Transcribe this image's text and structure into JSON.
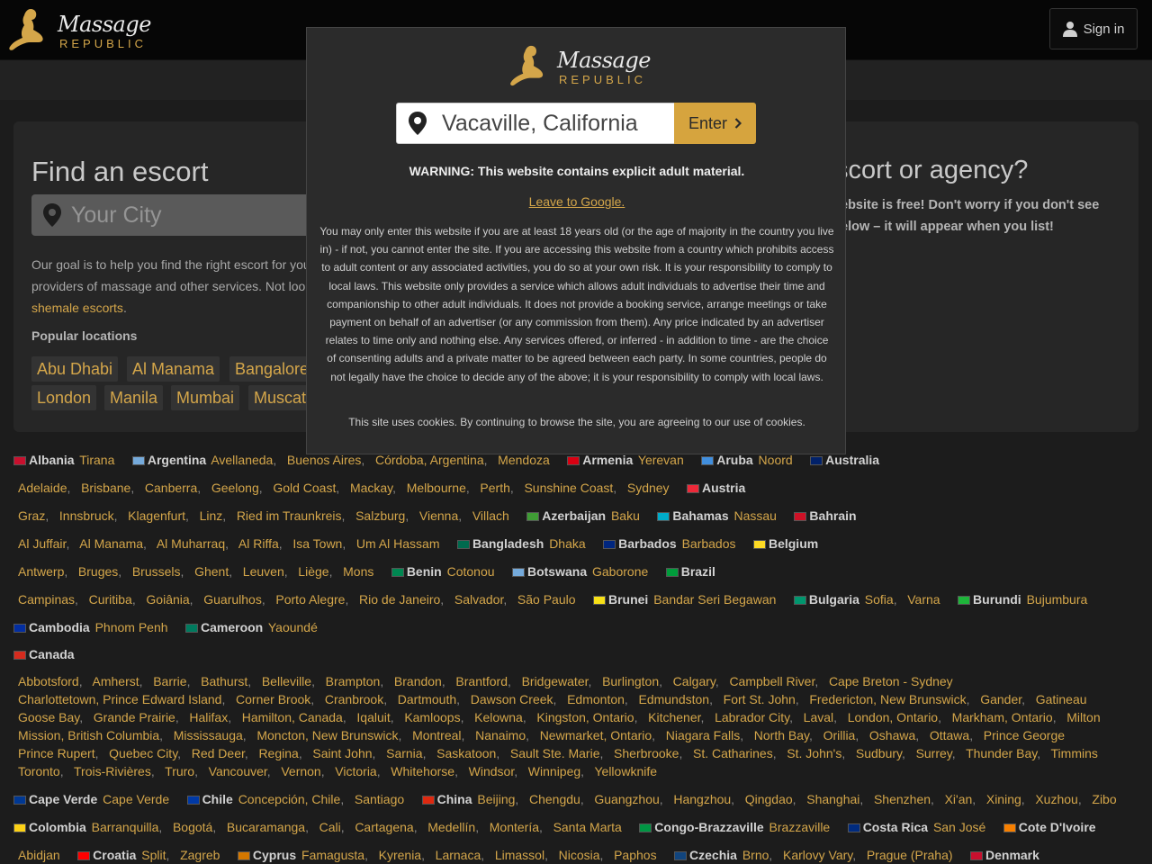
{
  "brand": {
    "word1": "Massage",
    "word2": "REPUBLIC"
  },
  "header": {
    "sign_in": "Sign in"
  },
  "find": {
    "title": "Find an escort",
    "placeholder": "Your City",
    "goal_lines": [
      "Our goal is to help you find the right escort for you",
      "providers of massage and other services. Not loo",
      "shemale escorts"
    ],
    "goal_tail": ".",
    "popular_heading": "Popular locations",
    "popular": [
      "Abu Dhabi",
      "Al Manama",
      "Bangalore",
      "London",
      "Manila",
      "Mumbai",
      "Muscat"
    ]
  },
  "list": {
    "title": "scort or agency?",
    "text_lines": [
      "ebsite is free! Don't worry if you don't see",
      "elow – it will appear when you list!"
    ]
  },
  "modal": {
    "city_value": "Vacaville, California",
    "enter_label": "Enter",
    "warning": "WARNING: This website contains explicit adult material.",
    "leave_link": "Leave to Google.",
    "disclaimer": "You may only enter this website if you are at least 18 years old (or the age of majority in the country you live in) - if not, you cannot enter the site. If you are accessing this website from a country which prohibits access to adult content or any associated activities, you do so at your own risk. It is your responsibility to comply to local laws. This website only provides a service which allows adult individuals to advertise their time and companionship to other adult individuals. It does not provide a booking service, arrange meetings or take payment on behalf of an advertiser (or any commission from them). Any price indicated by an advertiser relates to time only and nothing else. Any services offered, or inferred - in addition to time - are the choice of consenting adults and a private matter to be agreed between each party. In some countries, people do not legally have the choice to decide any of the above; it is your responsibility to comply with local laws.",
    "cookies": "This site uses cookies. By continuing to browse the site, you are agreeing to our use of cookies."
  },
  "country_rows": [
    [
      {
        "t": "c",
        "v": "Albania",
        "f": "#c8102e"
      },
      {
        "t": "city",
        "v": "Tirana"
      },
      {
        "t": "c",
        "v": "Argentina",
        "f": "#75aadb"
      },
      {
        "t": "city",
        "v": "Avellaneda"
      },
      {
        "t": "city",
        "v": "Buenos Aires"
      },
      {
        "t": "city",
        "v": "Córdoba, Argentina"
      },
      {
        "t": "city",
        "v": "Mendoza"
      },
      {
        "t": "c",
        "v": "Armenia",
        "f": "#d90012"
      },
      {
        "t": "city",
        "v": "Yerevan"
      },
      {
        "t": "c",
        "v": "Aruba",
        "f": "#418fde"
      },
      {
        "t": "city",
        "v": "Noord"
      },
      {
        "t": "c",
        "v": "Australia",
        "f": "#012169"
      }
    ],
    [
      {
        "t": "city",
        "v": "Adelaide"
      },
      {
        "t": "city",
        "v": "Brisbane"
      },
      {
        "t": "city",
        "v": "Canberra"
      },
      {
        "t": "city",
        "v": "Geelong"
      },
      {
        "t": "city",
        "v": "Gold Coast"
      },
      {
        "t": "city",
        "v": "Mackay"
      },
      {
        "t": "city",
        "v": "Melbourne"
      },
      {
        "t": "city",
        "v": "Perth"
      },
      {
        "t": "city",
        "v": "Sunshine Coast"
      },
      {
        "t": "city",
        "v": "Sydney"
      },
      {
        "t": "c",
        "v": "Austria",
        "f": "#ed2939"
      }
    ],
    [
      {
        "t": "city",
        "v": "Graz"
      },
      {
        "t": "city",
        "v": "Innsbruck"
      },
      {
        "t": "city",
        "v": "Klagenfurt"
      },
      {
        "t": "city",
        "v": "Linz"
      },
      {
        "t": "city",
        "v": "Ried im Traunkreis"
      },
      {
        "t": "city",
        "v": "Salzburg"
      },
      {
        "t": "city",
        "v": "Vienna"
      },
      {
        "t": "city",
        "v": "Villach"
      },
      {
        "t": "c",
        "v": "Azerbaijan",
        "f": "#3f9c35"
      },
      {
        "t": "city",
        "v": "Baku"
      },
      {
        "t": "c",
        "v": "Bahamas",
        "f": "#00abc9"
      },
      {
        "t": "city",
        "v": "Nassau"
      },
      {
        "t": "c",
        "v": "Bahrain",
        "f": "#ce1126"
      }
    ],
    [
      {
        "t": "city",
        "v": "Al Juffair"
      },
      {
        "t": "city",
        "v": "Al Manama"
      },
      {
        "t": "city",
        "v": "Al Muharraq"
      },
      {
        "t": "city",
        "v": "Al Riffa"
      },
      {
        "t": "city",
        "v": "Isa Town"
      },
      {
        "t": "city",
        "v": "Um Al Hassam"
      },
      {
        "t": "c",
        "v": "Bangladesh",
        "f": "#006a4e"
      },
      {
        "t": "city",
        "v": "Dhaka"
      },
      {
        "t": "c",
        "v": "Barbados",
        "f": "#00267f"
      },
      {
        "t": "city",
        "v": "Barbados"
      },
      {
        "t": "c",
        "v": "Belgium",
        "f": "#fdda24"
      }
    ],
    [
      {
        "t": "city",
        "v": "Antwerp"
      },
      {
        "t": "city",
        "v": "Bruges"
      },
      {
        "t": "city",
        "v": "Brussels"
      },
      {
        "t": "city",
        "v": "Ghent"
      },
      {
        "t": "city",
        "v": "Leuven"
      },
      {
        "t": "city",
        "v": "Liège"
      },
      {
        "t": "city",
        "v": "Mons"
      },
      {
        "t": "c",
        "v": "Benin",
        "f": "#008751"
      },
      {
        "t": "city",
        "v": "Cotonou"
      },
      {
        "t": "c",
        "v": "Botswana",
        "f": "#75aadb"
      },
      {
        "t": "city",
        "v": "Gaborone"
      },
      {
        "t": "c",
        "v": "Brazil",
        "f": "#009c3b"
      }
    ],
    [
      {
        "t": "city",
        "v": "Campinas"
      },
      {
        "t": "city",
        "v": "Curitiba"
      },
      {
        "t": "city",
        "v": "Goiânia"
      },
      {
        "t": "city",
        "v": "Guarulhos"
      },
      {
        "t": "city",
        "v": "Porto Alegre"
      },
      {
        "t": "city",
        "v": "Rio de Janeiro"
      },
      {
        "t": "city",
        "v": "Salvador"
      },
      {
        "t": "city",
        "v": "São Paulo"
      },
      {
        "t": "c",
        "v": "Brunei",
        "f": "#f7e017"
      },
      {
        "t": "city",
        "v": "Bandar Seri Begawan"
      },
      {
        "t": "c",
        "v": "Bulgaria",
        "f": "#00966e"
      },
      {
        "t": "city",
        "v": "Sofia"
      },
      {
        "t": "city",
        "v": "Varna"
      },
      {
        "t": "c",
        "v": "Burundi",
        "f": "#1eb53a"
      },
      {
        "t": "city",
        "v": "Bujumbura"
      }
    ],
    [
      {
        "t": "c",
        "v": "Cambodia",
        "f": "#032ea1"
      },
      {
        "t": "city",
        "v": "Phnom Penh"
      },
      {
        "t": "c",
        "v": "Cameroon",
        "f": "#007a5e"
      },
      {
        "t": "city",
        "v": "Yaoundé"
      }
    ],
    [
      {
        "t": "c",
        "v": "Canada",
        "f": "#d52b1e"
      }
    ],
    [
      {
        "t": "city",
        "v": "Abbotsford"
      },
      {
        "t": "city",
        "v": "Amherst"
      },
      {
        "t": "city",
        "v": "Barrie"
      },
      {
        "t": "city",
        "v": "Bathurst"
      },
      {
        "t": "city",
        "v": "Belleville"
      },
      {
        "t": "city",
        "v": "Brampton"
      },
      {
        "t": "city",
        "v": "Brandon"
      },
      {
        "t": "city",
        "v": "Brantford"
      },
      {
        "t": "city",
        "v": "Bridgewater"
      },
      {
        "t": "city",
        "v": "Burlington"
      },
      {
        "t": "city",
        "v": "Calgary"
      },
      {
        "t": "city",
        "v": "Campbell River"
      },
      {
        "t": "city",
        "v": "Cape Breton - Sydney"
      }
    ],
    [
      {
        "t": "city",
        "v": "Charlottetown, Prince Edward Island"
      },
      {
        "t": "city",
        "v": "Corner Brook"
      },
      {
        "t": "city",
        "v": "Cranbrook"
      },
      {
        "t": "city",
        "v": "Dartmouth"
      },
      {
        "t": "city",
        "v": "Dawson Creek"
      },
      {
        "t": "city",
        "v": "Edmonton"
      },
      {
        "t": "city",
        "v": "Edmundston"
      },
      {
        "t": "city",
        "v": "Fort St. John"
      },
      {
        "t": "city",
        "v": "Fredericton, New Brunswick"
      },
      {
        "t": "city",
        "v": "Gander"
      },
      {
        "t": "city",
        "v": "Gatineau"
      }
    ],
    [
      {
        "t": "city",
        "v": "Goose Bay"
      },
      {
        "t": "city",
        "v": "Grande Prairie"
      },
      {
        "t": "city",
        "v": "Halifax"
      },
      {
        "t": "city",
        "v": "Hamilton, Canada"
      },
      {
        "t": "city",
        "v": "Iqaluit"
      },
      {
        "t": "city",
        "v": "Kamloops"
      },
      {
        "t": "city",
        "v": "Kelowna"
      },
      {
        "t": "city",
        "v": "Kingston, Ontario"
      },
      {
        "t": "city",
        "v": "Kitchener"
      },
      {
        "t": "city",
        "v": "Labrador City"
      },
      {
        "t": "city",
        "v": "Laval"
      },
      {
        "t": "city",
        "v": "London, Ontario"
      },
      {
        "t": "city",
        "v": "Markham, Ontario"
      },
      {
        "t": "city",
        "v": "Milton"
      }
    ],
    [
      {
        "t": "city",
        "v": "Mission, British Columbia"
      },
      {
        "t": "city",
        "v": "Mississauga"
      },
      {
        "t": "city",
        "v": "Moncton, New Brunswick"
      },
      {
        "t": "city",
        "v": "Montreal"
      },
      {
        "t": "city",
        "v": "Nanaimo"
      },
      {
        "t": "city",
        "v": "Newmarket, Ontario"
      },
      {
        "t": "city",
        "v": "Niagara Falls"
      },
      {
        "t": "city",
        "v": "North Bay"
      },
      {
        "t": "city",
        "v": "Orillia"
      },
      {
        "t": "city",
        "v": "Oshawa"
      },
      {
        "t": "city",
        "v": "Ottawa"
      },
      {
        "t": "city",
        "v": "Prince George"
      }
    ],
    [
      {
        "t": "city",
        "v": "Prince Rupert"
      },
      {
        "t": "city",
        "v": "Quebec City"
      },
      {
        "t": "city",
        "v": "Red Deer"
      },
      {
        "t": "city",
        "v": "Regina"
      },
      {
        "t": "city",
        "v": "Saint John"
      },
      {
        "t": "city",
        "v": "Sarnia"
      },
      {
        "t": "city",
        "v": "Saskatoon"
      },
      {
        "t": "city",
        "v": "Sault Ste. Marie"
      },
      {
        "t": "city",
        "v": "Sherbrooke"
      },
      {
        "t": "city",
        "v": "St. Catharines"
      },
      {
        "t": "city",
        "v": "St. John's"
      },
      {
        "t": "city",
        "v": "Sudbury"
      },
      {
        "t": "city",
        "v": "Surrey"
      },
      {
        "t": "city",
        "v": "Thunder Bay"
      },
      {
        "t": "city",
        "v": "Timmins"
      }
    ],
    [
      {
        "t": "city",
        "v": "Toronto"
      },
      {
        "t": "city",
        "v": "Trois-Rivières"
      },
      {
        "t": "city",
        "v": "Truro"
      },
      {
        "t": "city",
        "v": "Vancouver"
      },
      {
        "t": "city",
        "v": "Vernon"
      },
      {
        "t": "city",
        "v": "Victoria"
      },
      {
        "t": "city",
        "v": "Whitehorse"
      },
      {
        "t": "city",
        "v": "Windsor"
      },
      {
        "t": "city",
        "v": "Winnipeg"
      },
      {
        "t": "city",
        "v": "Yellowknife"
      }
    ],
    [
      {
        "t": "c",
        "v": "Cape Verde",
        "f": "#003893"
      },
      {
        "t": "city",
        "v": "Cape Verde"
      },
      {
        "t": "c",
        "v": "Chile",
        "f": "#0039a6"
      },
      {
        "t": "city",
        "v": "Concepción, Chile"
      },
      {
        "t": "city",
        "v": "Santiago"
      },
      {
        "t": "c",
        "v": "China",
        "f": "#de2910"
      },
      {
        "t": "city",
        "v": "Beijing"
      },
      {
        "t": "city",
        "v": "Chengdu"
      },
      {
        "t": "city",
        "v": "Guangzhou"
      },
      {
        "t": "city",
        "v": "Hangzhou"
      },
      {
        "t": "city",
        "v": "Qingdao"
      },
      {
        "t": "city",
        "v": "Shanghai"
      },
      {
        "t": "city",
        "v": "Shenzhen"
      },
      {
        "t": "city",
        "v": "Xi'an"
      },
      {
        "t": "city",
        "v": "Xining"
      },
      {
        "t": "city",
        "v": "Xuzhou"
      },
      {
        "t": "city",
        "v": "Zibo"
      }
    ],
    [
      {
        "t": "c",
        "v": "Colombia",
        "f": "#fcd116"
      },
      {
        "t": "city",
        "v": "Barranquilla"
      },
      {
        "t": "city",
        "v": "Bogotá"
      },
      {
        "t": "city",
        "v": "Bucaramanga"
      },
      {
        "t": "city",
        "v": "Cali"
      },
      {
        "t": "city",
        "v": "Cartagena"
      },
      {
        "t": "city",
        "v": "Medellín"
      },
      {
        "t": "city",
        "v": "Montería"
      },
      {
        "t": "city",
        "v": "Santa Marta"
      },
      {
        "t": "c",
        "v": "Congo-Brazzaville",
        "f": "#009543"
      },
      {
        "t": "city",
        "v": "Brazzaville"
      },
      {
        "t": "c",
        "v": "Costa Rica",
        "f": "#002b7f"
      },
      {
        "t": "city",
        "v": "San José"
      },
      {
        "t": "c",
        "v": "Cote D'Ivoire",
        "f": "#f77f00"
      }
    ],
    [
      {
        "t": "city",
        "v": "Abidjan"
      },
      {
        "t": "c",
        "v": "Croatia",
        "f": "#ff0000"
      },
      {
        "t": "city",
        "v": "Split"
      },
      {
        "t": "city",
        "v": "Zagreb"
      },
      {
        "t": "c",
        "v": "Cyprus",
        "f": "#d57800"
      },
      {
        "t": "city",
        "v": "Famagusta"
      },
      {
        "t": "city",
        "v": "Kyrenia"
      },
      {
        "t": "city",
        "v": "Larnaca"
      },
      {
        "t": "city",
        "v": "Limassol"
      },
      {
        "t": "city",
        "v": "Nicosia"
      },
      {
        "t": "city",
        "v": "Paphos"
      },
      {
        "t": "c",
        "v": "Czechia",
        "f": "#11457e"
      },
      {
        "t": "city",
        "v": "Brno"
      },
      {
        "t": "city",
        "v": "Karlovy Vary"
      },
      {
        "t": "city",
        "v": "Prague (Praha)"
      },
      {
        "t": "c",
        "v": "Denmark",
        "f": "#c8102e"
      }
    ]
  ]
}
